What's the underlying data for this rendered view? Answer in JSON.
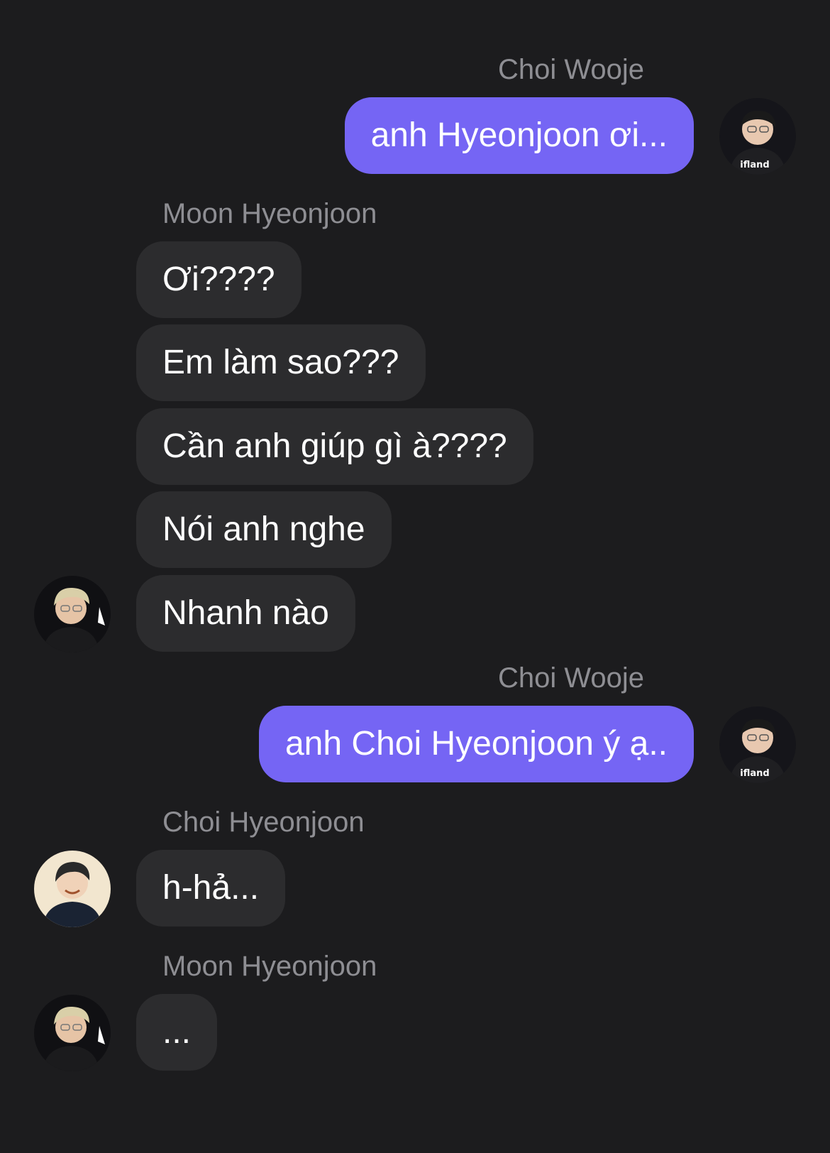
{
  "conversation": {
    "messages": [
      {
        "sender": "Choi Wooje",
        "direction": "outgoing",
        "text": "anh Hyeonjoon ơi..."
      },
      {
        "sender": "Moon Hyeonjoon",
        "direction": "incoming",
        "text": "Ơi????"
      },
      {
        "sender": "Moon Hyeonjoon",
        "direction": "incoming",
        "text": "Em làm sao???"
      },
      {
        "sender": "Moon Hyeonjoon",
        "direction": "incoming",
        "text": "Cần anh giúp gì à????"
      },
      {
        "sender": "Moon Hyeonjoon",
        "direction": "incoming",
        "text": "Nói anh nghe"
      },
      {
        "sender": "Moon Hyeonjoon",
        "direction": "incoming",
        "text": "Nhanh nào"
      },
      {
        "sender": "Choi Wooje",
        "direction": "outgoing",
        "text": "anh Choi Hyeonjoon ý ạ.."
      },
      {
        "sender": "Choi Hyeonjoon",
        "direction": "incoming",
        "text": "h-hả..."
      },
      {
        "sender": "Moon Hyeonjoon",
        "direction": "incoming",
        "text": "..."
      }
    ],
    "sender_labels": [
      "Choi Wooje",
      "Moon Hyeonjoon",
      "Choi Wooje",
      "Choi Hyeonjoon",
      "Moon Hyeonjoon"
    ],
    "avatar_jersey_text": "ifland"
  },
  "colors": {
    "background": "#1c1c1e",
    "outgoing_bubble": "#7565f4",
    "incoming_bubble": "#2c2c2e",
    "sender_name": "#8e8e93",
    "message_text": "#ffffff"
  }
}
